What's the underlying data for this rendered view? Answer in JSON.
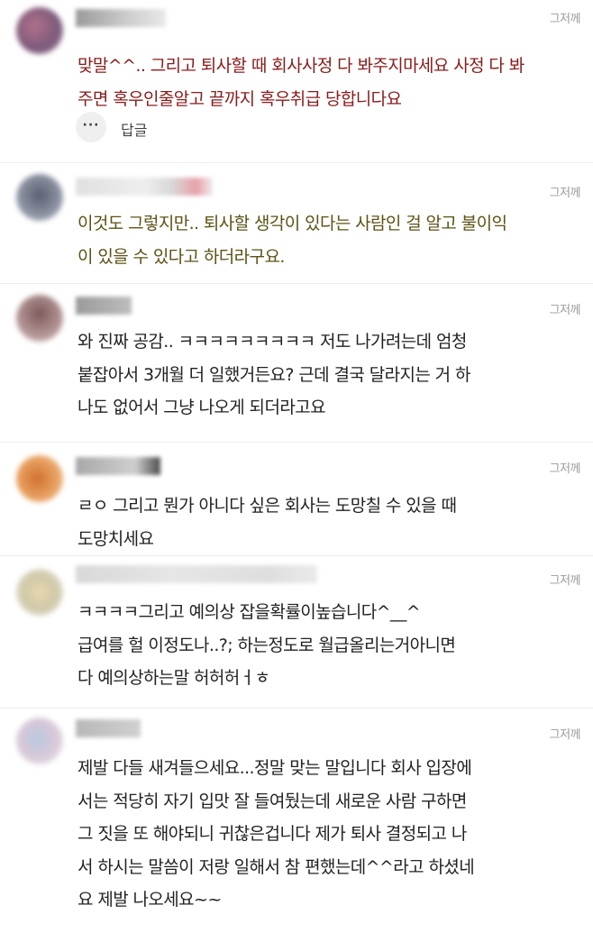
{
  "comments": [
    {
      "time": "그저께",
      "lines": [
        "맞말^^.. 그리고 퇴사할 때 회사사정 다 봐주지마세요 사정 다 봐",
        "주면 혹우인줄알고 끝까지 혹우취급 당합니다요"
      ],
      "more_label": "···",
      "reply_label": "답글"
    },
    {
      "time": "그저께",
      "lines": [
        "이것도 그렇지만.. 퇴사할 생각이 있다는 사람인 걸 알고 불이익",
        "이 있을 수 있다고 하더라구요."
      ]
    },
    {
      "time": "그저께",
      "lines": [
        "와 진짜 공감.. ㅋㅋㅋㅋㅋㅋㅋㅋㅋ 저도 나가려는데 엄청",
        "붙잡아서 3개월 더 일했거든요? 근데 결국 달라지는 거 하",
        "나도 없어서 그냥 나오게 되더라고요"
      ]
    },
    {
      "time": "그저께",
      "lines": [
        "ㄹㅇ 그리고 뭔가 아니다 싶은 회사는 도망칠 수 있을 때",
        "도망치세요"
      ]
    },
    {
      "time": "그저께",
      "lines": [
        "ㅋㅋㅋㅋ그리고 예의상 잡을확률이높습니다^__^",
        "급여를 헐 이정도나..?; 하는정도로 월급올리는거아니면",
        "다 예의상하는말 허허허ㅓㅎ"
      ]
    },
    {
      "time": "그저께",
      "lines": [
        "제발 다들 새겨들으세요...정말 맞는 말입니다 회사 입장에",
        "서는 적당히 자기 입맛 잘 들여뒀는데 새로운 사람 구하면",
        "그 짓을 또 해야되니 귀찮은겁니다 제가 퇴사 결정되고 나",
        "서 하시는 말씀이 저랑 일해서 참 편했는데^^라고 하셨네",
        "요 제발 나오세요~~"
      ]
    }
  ],
  "colors": {
    "text_dark": "#222222",
    "text_red": "#8a1b1b",
    "text_olive": "#5d5215",
    "time_gray": "#9a9a9a"
  }
}
